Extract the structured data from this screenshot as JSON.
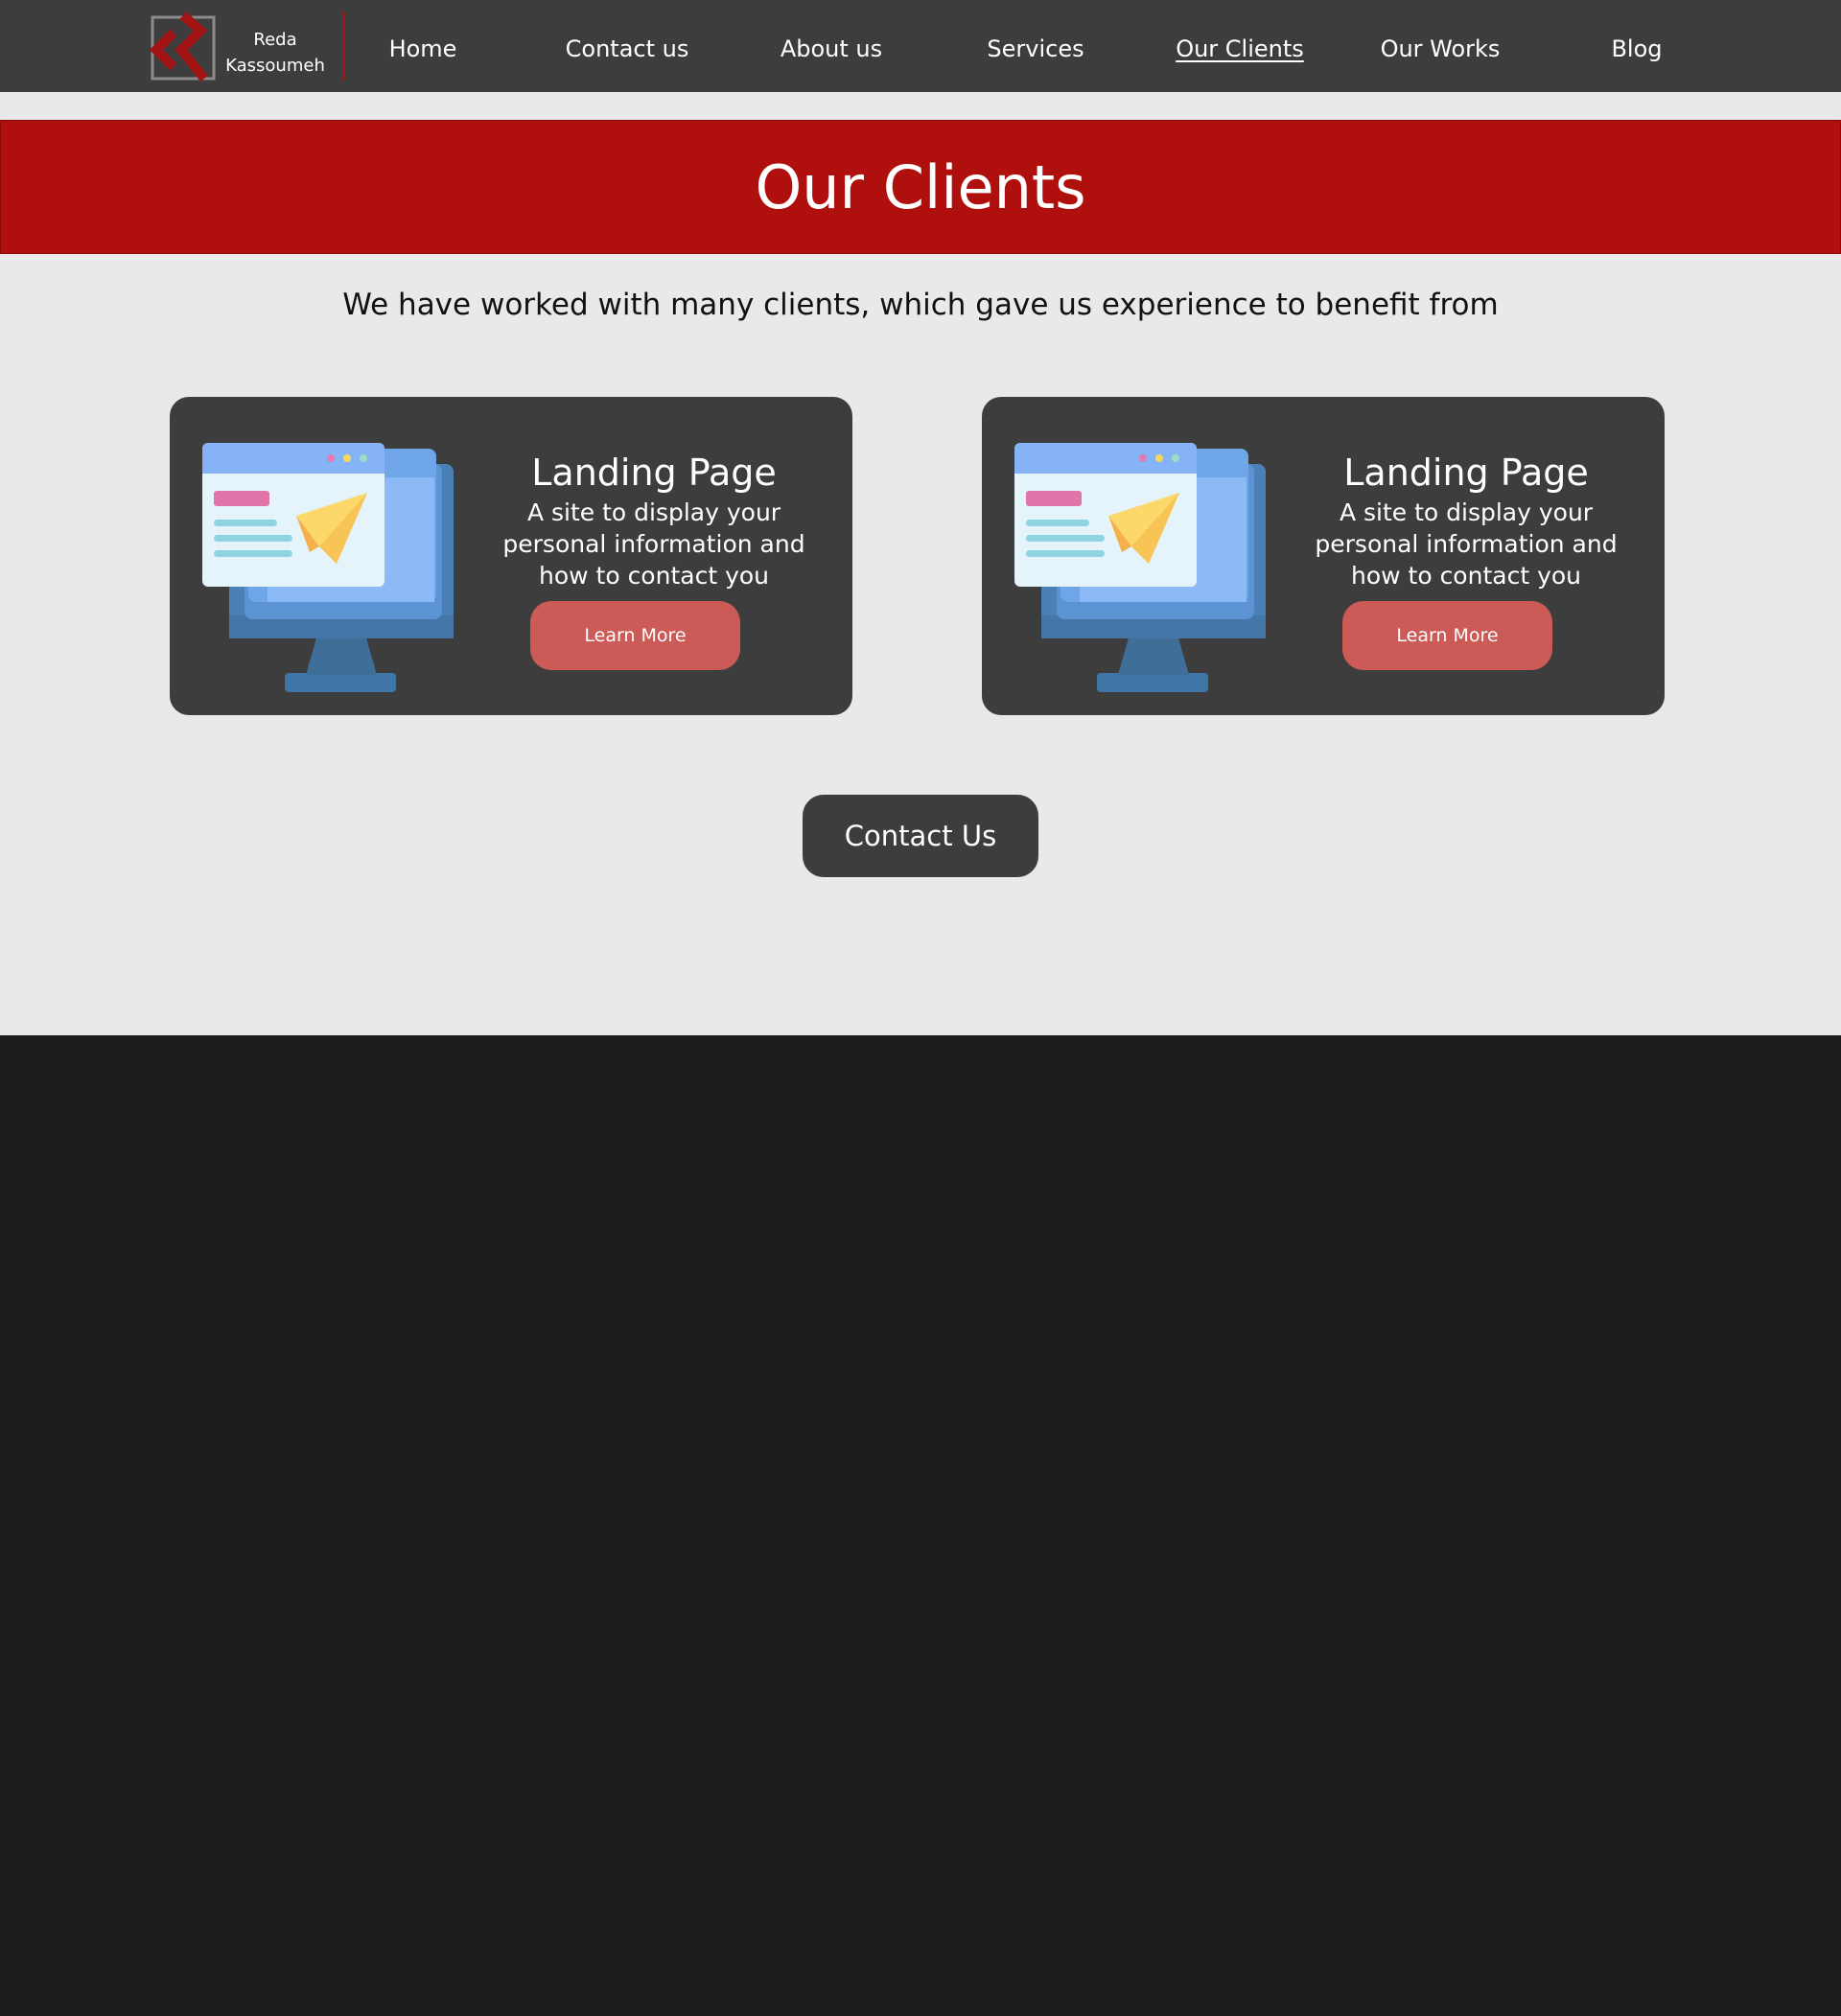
{
  "nav": {
    "logo_line1": "Reda",
    "logo_line2": "Kassoumeh",
    "items": [
      {
        "label": "Home"
      },
      {
        "label": "Contact us"
      },
      {
        "label": "About us"
      },
      {
        "label": "Services"
      },
      {
        "label": "Our Clients",
        "active": true
      },
      {
        "label": "Our Works"
      },
      {
        "label": "Blog"
      }
    ]
  },
  "banner": {
    "title": "Our Clients"
  },
  "intro": "We have worked with many clients, which gave us experience to benefit from",
  "cards": [
    {
      "title": "Landing Page",
      "description": "A site to display your personal information and how to contact you",
      "button": "Learn More",
      "icon": "computer-send-icon"
    },
    {
      "title": "Landing Page",
      "description": "A site to display your personal information and how to contact you",
      "button": "Learn More",
      "icon": "computer-send-icon"
    }
  ],
  "contact_button": "Contact Us",
  "colors": {
    "nav_bg": "#3d3d3d",
    "banner_bg": "#b0100d",
    "section_bg": "#e9e9e9",
    "footer_bg": "#1c1c1b",
    "card_bg": "#3d3d3d",
    "accent_button": "#cc5a56"
  }
}
